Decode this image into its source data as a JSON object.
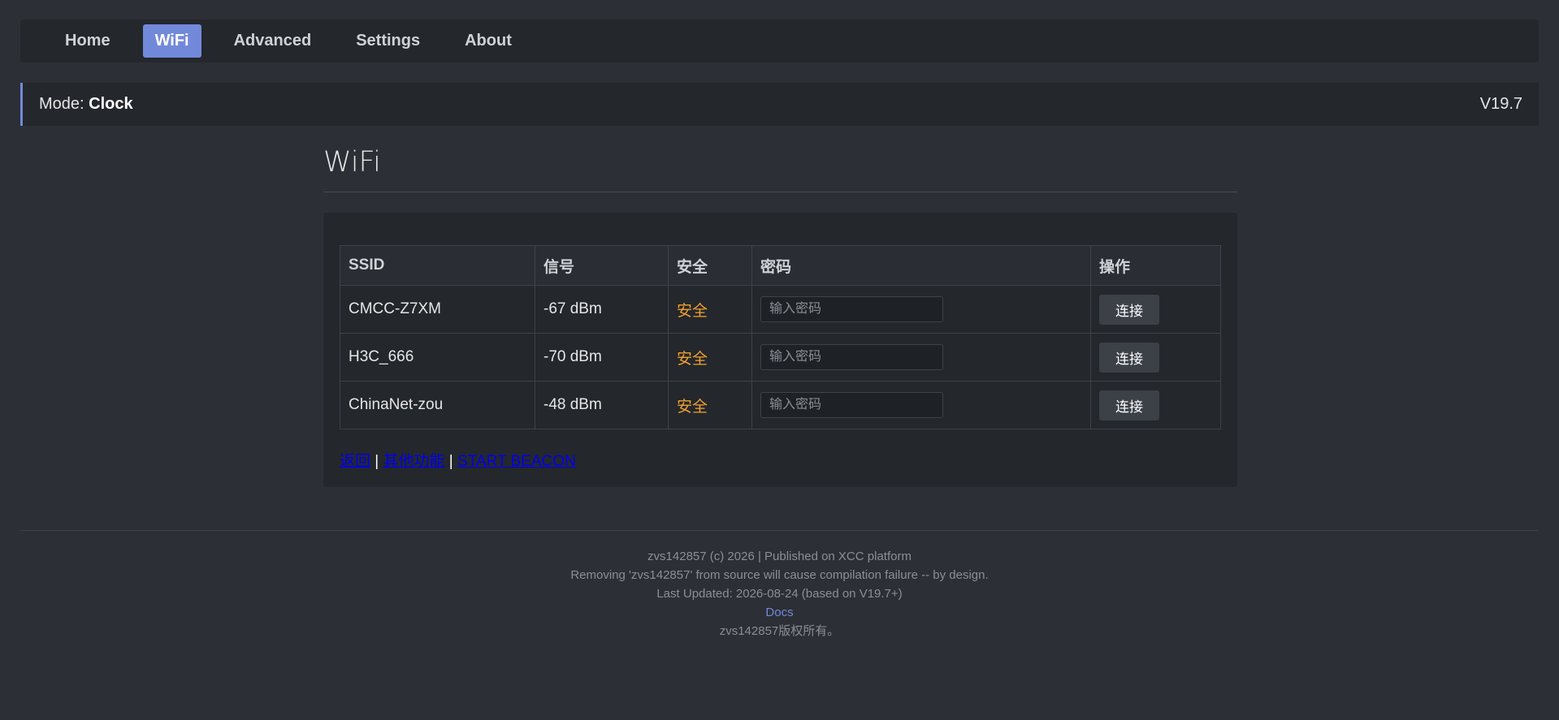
{
  "nav": {
    "items": [
      {
        "label": "Home",
        "active": false
      },
      {
        "label": "WiFi",
        "active": true
      },
      {
        "label": "Advanced",
        "active": false
      },
      {
        "label": "Settings",
        "active": false
      },
      {
        "label": "About",
        "active": false
      }
    ]
  },
  "modebar": {
    "prefix": "Mode: ",
    "mode": "Clock",
    "version": "V19.7"
  },
  "page": {
    "title": "WiFi"
  },
  "table": {
    "headers": [
      "SSID",
      "信号",
      "安全",
      "密码",
      "操作"
    ],
    "password_placeholder": "输入密码",
    "connect_label": "连接",
    "rows": [
      {
        "ssid": "CMCC-Z7XM",
        "signal": "-67 dBm",
        "security": "安全"
      },
      {
        "ssid": "H3C_666",
        "signal": "-70 dBm",
        "security": "安全"
      },
      {
        "ssid": "ChinaNet-zou",
        "signal": "-48 dBm",
        "security": "安全"
      }
    ]
  },
  "links": {
    "back": "返回",
    "separator": " | ",
    "other": "其他功能",
    "beacon": "START BEACON"
  },
  "footer": {
    "line1": "zvs142857 (c) 2026 | Published on XCC platform",
    "line2": "Removing 'zvs142857' from source will cause compilation failure -- by design.",
    "line3": "Last Updated: 2026-08-24 (based on V19.7+)",
    "docs": "Docs",
    "line5": "zvs142857版权所有。"
  },
  "colors": {
    "accent": "#7289da",
    "secure": "#f0a030",
    "link": "#0000ee"
  }
}
